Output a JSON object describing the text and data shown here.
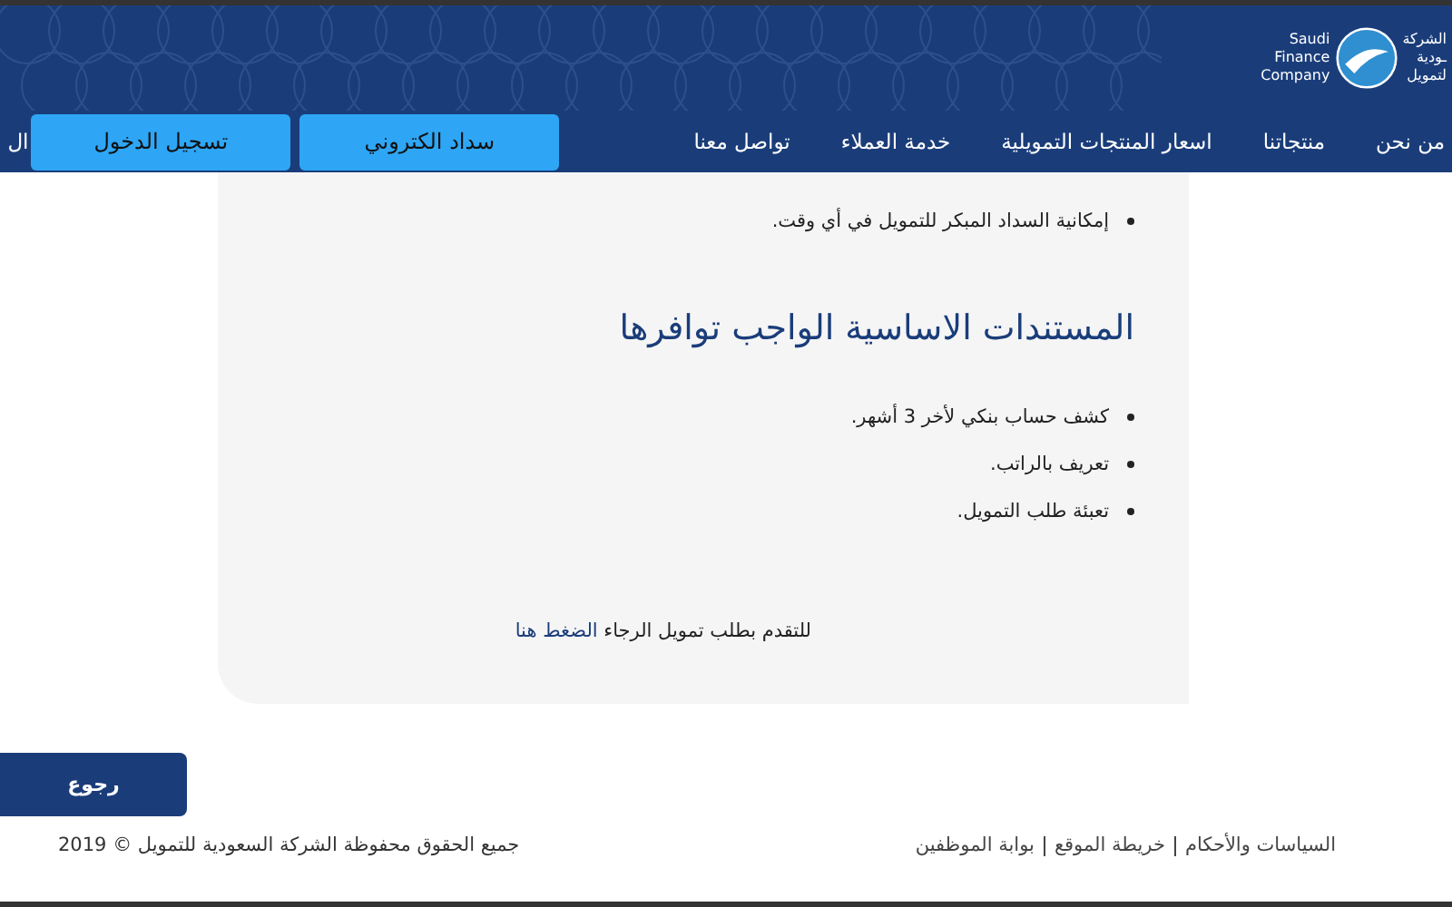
{
  "header": {
    "logo_latin": [
      "Saudi",
      "Finance",
      "Company"
    ],
    "logo_arabic": [
      "الشركة",
      "ـودية",
      "لتمويل"
    ]
  },
  "nav": [
    {
      "label": "من نحن"
    },
    {
      "label": "منتجاتنا"
    },
    {
      "label": "اسعار المنتجات التمويلية"
    },
    {
      "label": "خدمة العملاء"
    },
    {
      "label": "تواصل معنا"
    }
  ],
  "buttons": [
    "سداد الكتروني",
    "تسجيل الدخول"
  ],
  "nav_cut": "ال",
  "content": {
    "bullets_top": [
      "إمكانية السداد المبكر للتمويل في أي وقت."
    ],
    "heading": "المستندات الاساسية الواجب توافرها",
    "bullets": [
      "كشف حساب بنكي لأخر 3 أشهر.",
      "تعريف بالراتب.",
      "تعبئة طلب التمويل."
    ],
    "apply_text": "للتقدم بطلب تمويل الرجاء",
    "apply_link": "الضغط هنا"
  },
  "back_button": "رجوع",
  "footer": {
    "links": [
      "السياسات والأحكام",
      "خريطة الموقع",
      "بوابة الموظفين"
    ],
    "copyright": "جميع الحقوق محفوظة الشركة السعودية للتمويل © 2019"
  }
}
